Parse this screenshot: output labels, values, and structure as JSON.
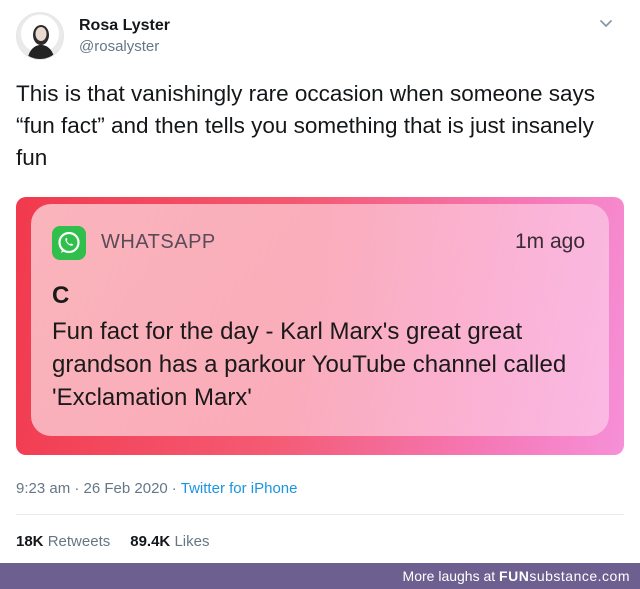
{
  "tweet": {
    "display_name": "Rosa Lyster",
    "handle": "@rosalyster",
    "text": "This is that vanishingly rare occasion when someone says “fun fact” and then tells you something that is just insanely fun",
    "timestamp": "9:23 am · 26 Feb 2020",
    "separator": "·",
    "source": "Twitter for iPhone",
    "retweets_count": "18K",
    "retweets_label": "Retweets",
    "likes_count": "89.4K",
    "likes_label": "Likes"
  },
  "notification": {
    "app_name": "WHATSAPP",
    "time_ago": "1m ago",
    "sender": "C",
    "message": "Fun fact for the day - Karl Marx's great great grandson has a parkour YouTube channel called 'Exclamation Marx'",
    "icon": "whatsapp-icon"
  },
  "footer": {
    "prefix": "More laughs at",
    "brand_main": "FUN",
    "brand_thin": "substance",
    "brand_suffix": ".com"
  },
  "icons": {
    "more": "chevron-down-icon",
    "avatar": "profile-photo"
  },
  "colors": {
    "link": "#1b95e0",
    "muted": "#657786",
    "footer_bg": "#6d5f90",
    "notification_red": "#f2394d",
    "notification_pink": "#f690d8",
    "whatsapp_green": "#2fbf4a"
  }
}
